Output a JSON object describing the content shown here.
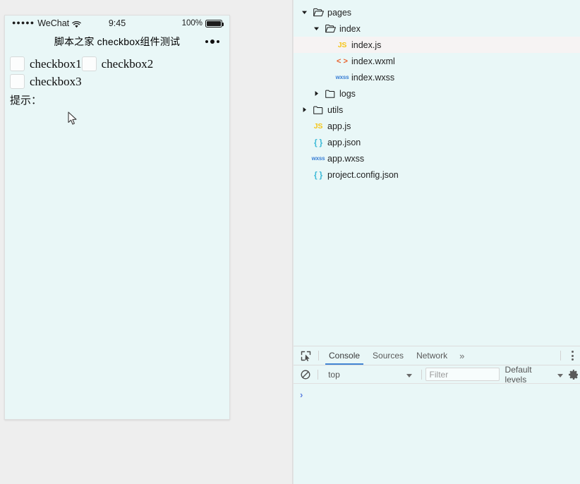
{
  "colors": {
    "app_bg": "#eeeeee",
    "panel_bg": "#e9f7f7",
    "accent_tab": "#4285d4",
    "selected_row": "#f6f3f3",
    "js_icon": "#f5c518",
    "wxml_icon": "#e8612c",
    "wxss_icon": "#3a7fd5",
    "json_icon": "#3fbbd8",
    "prompt": "#5c7fe0"
  },
  "simulator": {
    "status_bar": {
      "signal_dots": "●●●●●",
      "carrier": "WeChat",
      "wifi_icon": "wifi-icon",
      "time": "9:45",
      "battery_percent": "100%",
      "battery_icon": "battery-icon"
    },
    "nav_bar": {
      "title": "脚本之家 checkbox组件测试",
      "capsule_icon": "more-capsule-icon"
    },
    "page": {
      "checkbox_rows": [
        [
          {
            "label": "checkbox1",
            "checked": false
          },
          {
            "label": "checkbox2",
            "checked": false
          }
        ],
        [
          {
            "label": "checkbox3",
            "checked": false
          }
        ]
      ],
      "tip_label": "提示：",
      "tip_value": ""
    },
    "cursor_icon": "arrow-cursor"
  },
  "devtools": {
    "file_tree": [
      {
        "depth": 0,
        "twisty": "down",
        "icon": "folder-open-icon",
        "name": "pages",
        "selected": false
      },
      {
        "depth": 1,
        "twisty": "down",
        "icon": "folder-open-icon",
        "name": "index",
        "selected": false
      },
      {
        "depth": 2,
        "twisty": "none",
        "icon": "js-file-icon",
        "name": "index.js",
        "selected": true
      },
      {
        "depth": 2,
        "twisty": "none",
        "icon": "wxml-file-icon",
        "name": "index.wxml",
        "selected": false
      },
      {
        "depth": 2,
        "twisty": "none",
        "icon": "wxss-file-icon",
        "name": "index.wxss",
        "selected": false
      },
      {
        "depth": 1,
        "twisty": "right",
        "icon": "folder-icon",
        "name": "logs",
        "selected": false
      },
      {
        "depth": 0,
        "twisty": "right",
        "icon": "folder-icon",
        "name": "utils",
        "selected": false
      },
      {
        "depth": 0,
        "twisty": "none",
        "icon": "js-file-icon",
        "name": "app.js",
        "selected": false
      },
      {
        "depth": 0,
        "twisty": "none",
        "icon": "json-file-icon",
        "name": "app.json",
        "selected": false
      },
      {
        "depth": 0,
        "twisty": "none",
        "icon": "wxss-file-icon",
        "name": "app.wxss",
        "selected": false
      },
      {
        "depth": 0,
        "twisty": "none",
        "icon": "json-file-icon",
        "name": "project.config.json",
        "selected": false
      }
    ],
    "icon_badges": {
      "js": "JS",
      "wxml": "< >",
      "wxss": "wxss",
      "json": "{ }"
    },
    "console": {
      "inspect_icon": "inspect-element-icon",
      "tabs": [
        {
          "label": "Console",
          "active": true
        },
        {
          "label": "Sources",
          "active": false
        },
        {
          "label": "Network",
          "active": false
        }
      ],
      "more_tabs_icon": "»",
      "kebab_icon": "more-options-icon",
      "clear_icon": "clear-console-icon",
      "context_value": "top",
      "context_caret_icon": "chevron-down-icon",
      "filter_placeholder": "Filter",
      "filter_value": "",
      "levels_label": "Default levels",
      "levels_caret_icon": "chevron-down-icon",
      "settings_icon": "gear-icon",
      "prompt_symbol": "›",
      "messages": []
    }
  }
}
